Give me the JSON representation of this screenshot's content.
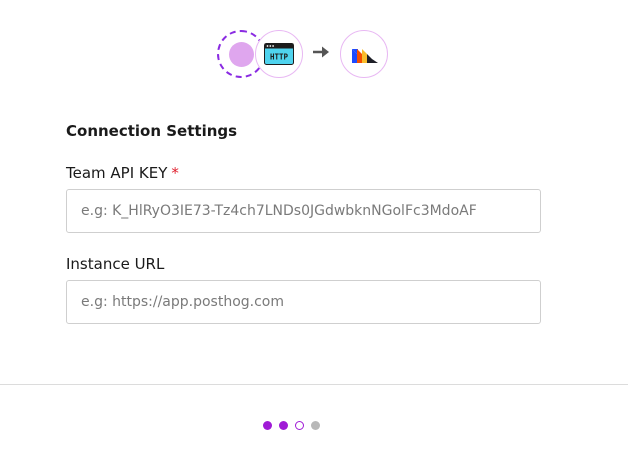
{
  "header": {
    "icons": {
      "source": "source-placeholder-icon",
      "http": "http-icon",
      "arrow": "arrow-right-icon",
      "destination": "destination-logo-icon"
    },
    "http_text": "HTTP"
  },
  "form": {
    "section_title": "Connection Settings",
    "fields": [
      {
        "label": "Team API KEY",
        "required_mark": "*",
        "value": "",
        "placeholder": "e.g: K_HlRyO3IE73-Tz4ch7LNDs0JGdwbknNGolFc3MdoAF"
      },
      {
        "label": "Instance URL",
        "value": "",
        "placeholder": "e.g: https://app.posthog.com"
      }
    ]
  },
  "stepper": {
    "steps": [
      "done",
      "done",
      "current",
      "pending"
    ]
  },
  "colors": {
    "accent": "#a01bd6",
    "required": "#e0202e",
    "icon_border": "#e8b8f3"
  }
}
